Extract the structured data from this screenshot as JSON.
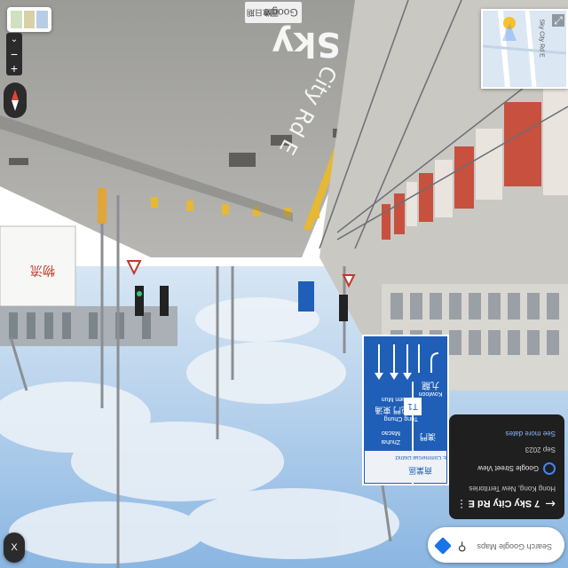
{
  "app": {
    "title": "Google Maps Street View"
  },
  "watermarks": {
    "google": "Google",
    "mapdata": "圖像日期"
  },
  "street_label": {
    "line1": "Sky",
    "line2": "City Rd E"
  },
  "sign": {
    "kowloon_cn": "九龍",
    "kowloon_en": "Kowloon",
    "tuen_cn": "屯門 東涌",
    "tuen_en": "Tuen Mun",
    "tung_en": "Tung Chung",
    "macao_cn": "澳門",
    "macao_en": "Macao",
    "zhuhai_en": "Zhuhai",
    "commercial_cn": "商業區",
    "commercial_en": "E   Commercial District",
    "route": "T1"
  },
  "controls": {
    "zoom_in": "+",
    "zoom_out": "−",
    "expand_minimap": "⤢",
    "close": "X"
  },
  "minimap": {
    "road_label": "Sky City Rd E"
  },
  "info_card": {
    "title": "7 Sky City Rd E",
    "subtitle": "Hong Kong, New Territories",
    "source": "Google Street View",
    "date": "Sep 2023",
    "more_dates": "See more dates"
  },
  "search": {
    "placeholder": "Search Google Maps"
  },
  "colors": {
    "accent_blue": "#1a73e8",
    "sign_blue": "#1f5fb7",
    "card_bg": "#1f1f1f"
  }
}
